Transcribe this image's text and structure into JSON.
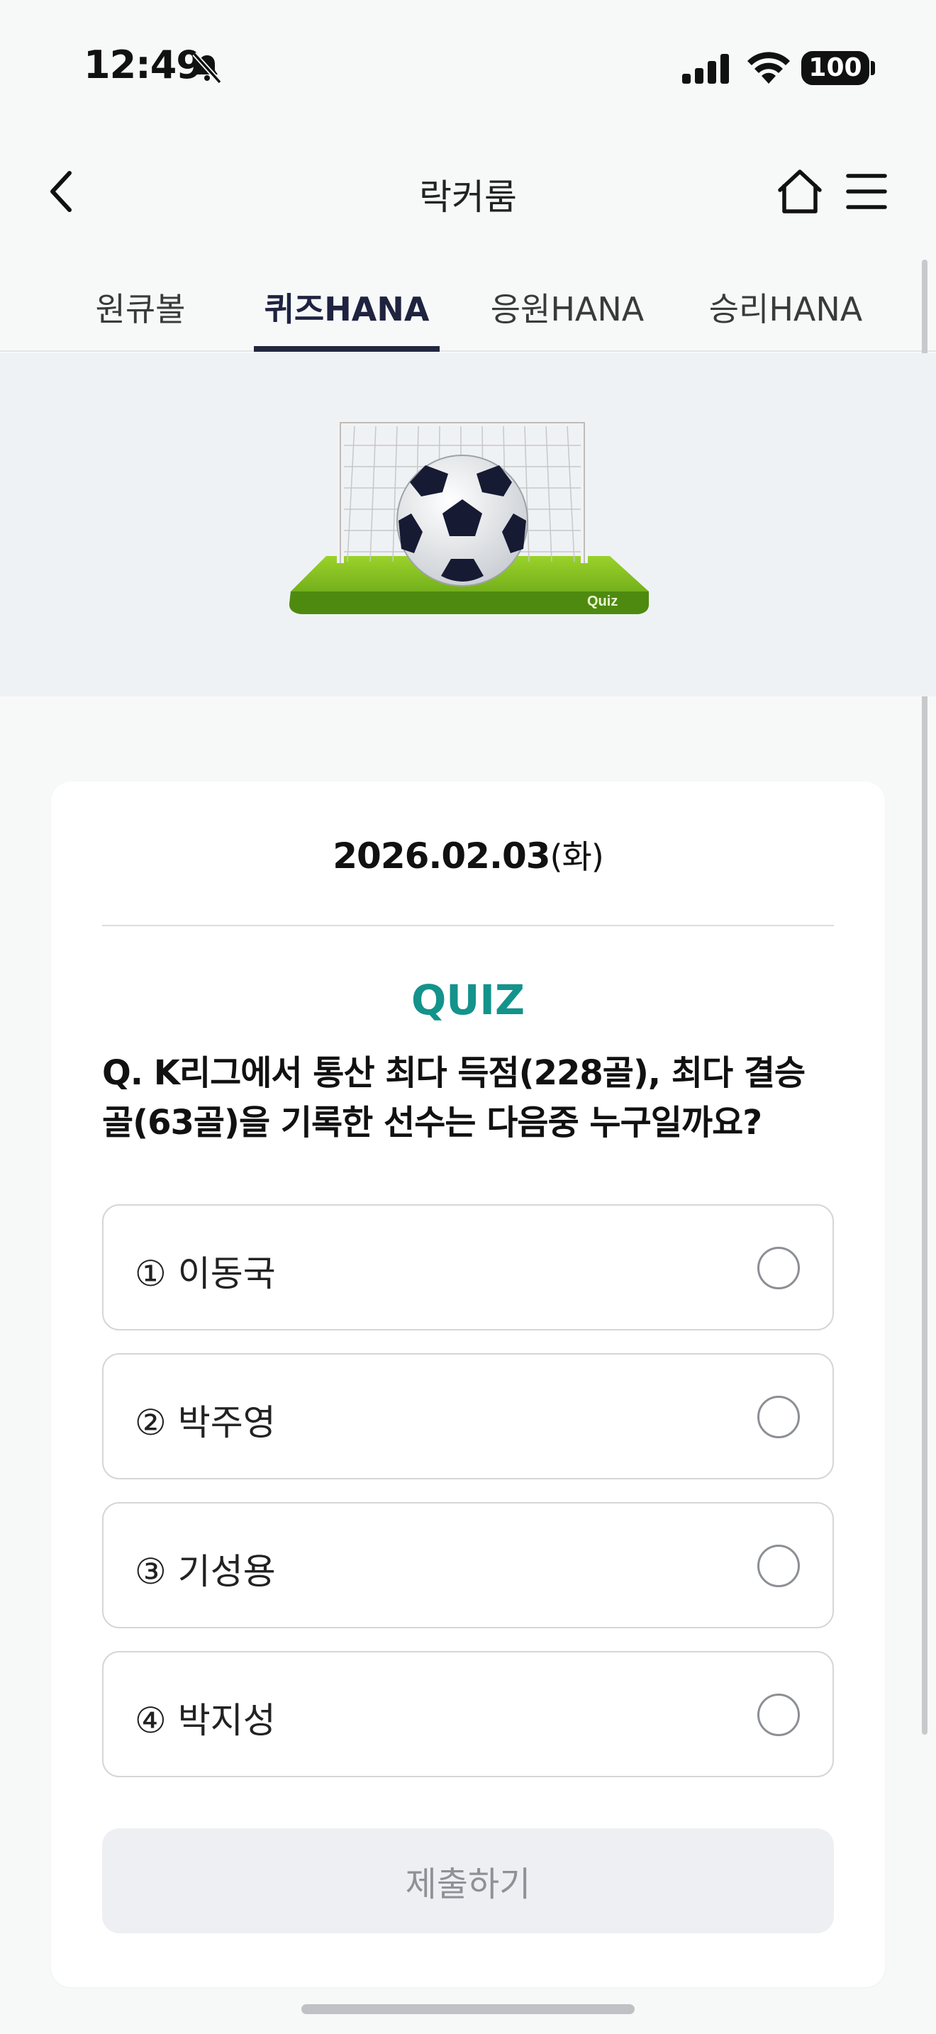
{
  "status_bar": {
    "time": "12:49",
    "battery": "100",
    "icons": [
      "bell-slash-icon",
      "signal-icon",
      "wifi-icon",
      "battery-icon"
    ]
  },
  "header": {
    "title": "락커룸",
    "icons": [
      "back-chevron-icon",
      "home-icon",
      "menu-icon"
    ]
  },
  "tabs": [
    {
      "label": "원큐볼",
      "active": false
    },
    {
      "label": "퀴즈HANA",
      "active": true
    },
    {
      "label": "응원HANA",
      "active": false
    },
    {
      "label": "승리HANA",
      "active": false
    }
  ],
  "banner": {
    "image_text": "Quiz"
  },
  "quiz": {
    "date": "2026.02.03",
    "day_of_week": "(화)",
    "label": "QUIZ",
    "question_line1": "Q. K리그에서 통산 최다 득점(228골), 최다 결승",
    "question_line2": "골(63골)을 기록한 선수는 다음중 누구일까요?",
    "options": [
      {
        "label": "① 이동국",
        "selected": false
      },
      {
        "label": "② 박주영",
        "selected": false
      },
      {
        "label": "③ 기성용",
        "selected": false
      },
      {
        "label": "④ 박지성",
        "selected": false
      }
    ],
    "submit_label": "제출하기"
  },
  "colors": {
    "accent": "#13938b",
    "tab_active": "#23263f",
    "background": "#f7f9f9",
    "banner_bg": "#eff2f5",
    "submit_bg": "#eeeff2"
  }
}
